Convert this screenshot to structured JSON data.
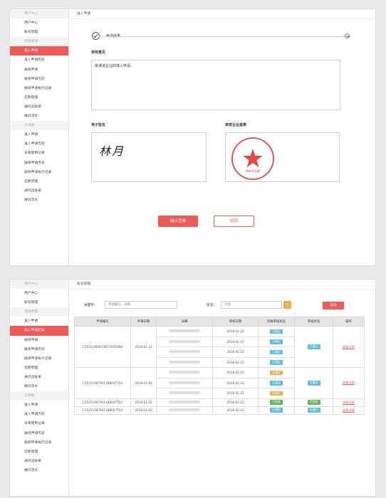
{
  "sidebar_items": [
    {
      "label": "用户中心",
      "type": "group"
    },
    {
      "label": "用户中心",
      "type": "item"
    },
    {
      "label": "账号管理",
      "type": "item"
    },
    {
      "label": "保函保理",
      "type": "group"
    },
    {
      "label": "准入申请",
      "type": "item"
    },
    {
      "label": "准入申请历史",
      "type": "item"
    },
    {
      "label": "融资申请",
      "type": "item"
    },
    {
      "label": "融资申请历史",
      "type": "item"
    },
    {
      "label": "融资申请执行记录",
      "type": "item"
    },
    {
      "label": "还款管理",
      "type": "item"
    },
    {
      "label": "通讯出账单",
      "type": "item"
    },
    {
      "label": "做日流水",
      "type": "item"
    },
    {
      "label": "订单融",
      "type": "group"
    },
    {
      "label": "准入申请",
      "type": "item"
    },
    {
      "label": "准入申请历史",
      "type": "item"
    },
    {
      "label": "日单使用记录",
      "type": "item"
    },
    {
      "label": "融资申请历史",
      "type": "item"
    },
    {
      "label": "融资申请执行记录",
      "type": "item"
    },
    {
      "label": "还款管理",
      "type": "item"
    },
    {
      "label": "通讯出账单",
      "type": "item"
    },
    {
      "label": "做日流水",
      "type": "item"
    }
  ],
  "panel1": {
    "breadcrumb": "准入申请",
    "active_index": 4,
    "result_label": "申请结果",
    "opinion_label": "审核意见",
    "opinion_text": "批准该企业的准入申请。",
    "signature_label": "电子签名",
    "signature_text": "林月",
    "seal_label": "审核企业盖章",
    "seal_text": "审核专用章",
    "confirm_button": "确认签章",
    "reject_button": "驳回"
  },
  "panel2": {
    "breadcrumb": "账号管理",
    "active_index": 5,
    "keyword_label": "关键字：",
    "keyword_placeholder": "申请编号、详细",
    "status_label": "状态：",
    "status_value": "全部",
    "search_button": "查询",
    "columns": [
      "申请编号",
      "申请日期",
      "详细",
      "审核日期",
      "资格审核状态",
      "审核状态",
      "操作"
    ],
    "groups": [
      {
        "id": "C25151966678673165468",
        "date": "2018-02-23",
        "audit_status": "已通过",
        "audit_color": "blue",
        "op": "查看详情",
        "rows": [
          {
            "date": "2018-02-23",
            "badge": "已通过",
            "color": "blue"
          },
          {
            "date": "2018-02-23",
            "badge": "已通过",
            "color": "blue"
          },
          {
            "date": "2018-02-23",
            "badge": "已通过",
            "color": "blue"
          },
          {
            "date": "2018-02-23",
            "badge": "已通过",
            "color": "blue"
          }
        ]
      },
      {
        "id": "C25151487941188047554",
        "date": "2018-01-02",
        "audit_status": "已通过",
        "audit_color": "blue",
        "op": "查看详情",
        "rows": [
          {
            "date": "2018-02-23",
            "badge": "未通过",
            "color": "orange"
          },
          {
            "date": "2018-02-23",
            "badge": "已通过",
            "color": "blue"
          },
          {
            "date": "2018-02-23",
            "badge": "未通过",
            "color": "orange"
          }
        ]
      },
      {
        "id": "C25151487941188047554",
        "date": "2018-01-02",
        "audit_status": "已完成",
        "audit_color": "green",
        "op": "查看详情",
        "rows": [
          {
            "date": "2018-02-23",
            "badge": "已完成",
            "color": "green"
          }
        ]
      },
      {
        "id": "C25151487941188047554",
        "date": "2018-01-02",
        "audit_status": "已通过",
        "audit_color": "blue",
        "op": "查看详情",
        "rows": [
          {
            "date": "2018-02-23",
            "badge": "已通过",
            "color": "blue"
          }
        ]
      }
    ]
  },
  "colors": {
    "accent": "#ef5a58",
    "blue": "#5bc0de",
    "orange": "#f0ad4e",
    "green": "#5cb85c"
  }
}
